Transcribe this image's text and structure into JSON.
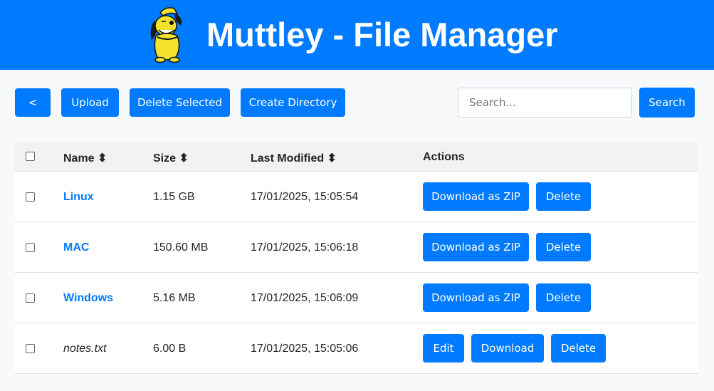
{
  "header": {
    "title": "Muttley - File Manager"
  },
  "toolbar": {
    "back_label": "<",
    "upload_label": "Upload",
    "delete_selected_label": "Delete Selected",
    "create_directory_label": "Create Directory",
    "search_placeholder": "Search...",
    "search_value": "",
    "search_button_label": "Search"
  },
  "table": {
    "headers": {
      "name": "Name ⬍",
      "size": "Size ⬍",
      "modified": "Last Modified ⬍",
      "actions": "Actions"
    },
    "rows": [
      {
        "name": "Linux",
        "size": "1.15 GB",
        "modified": "17/01/2025, 15:05:54",
        "download": "Download as ZIP",
        "delete": "Delete"
      },
      {
        "name": "MAC",
        "size": "150.60 MB",
        "modified": "17/01/2025, 15:06:18",
        "download": "Download as ZIP",
        "delete": "Delete"
      },
      {
        "name": "Windows",
        "size": "5.16 MB",
        "modified": "17/01/2025, 15:06:09",
        "download": "Download as ZIP",
        "delete": "Delete"
      },
      {
        "name": "notes.txt",
        "size": "6.00 B",
        "modified": "17/01/2025, 15:05:06",
        "edit": "Edit",
        "download": "Download",
        "delete": "Delete"
      }
    ]
  },
  "colors": {
    "primary": "#007bff",
    "background": "#f8f9fa",
    "logo_yellow": "#f2e22c"
  }
}
